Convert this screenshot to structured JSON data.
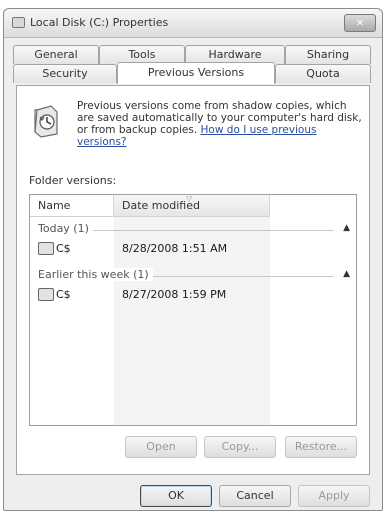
{
  "window": {
    "title": "Local Disk (C:) Properties",
    "close_label": "✕"
  },
  "tabs_row1": [
    {
      "label": "General"
    },
    {
      "label": "Tools"
    },
    {
      "label": "Hardware"
    },
    {
      "label": "Sharing"
    }
  ],
  "tabs_row2": [
    {
      "label": "Security"
    },
    {
      "label": "Previous Versions"
    },
    {
      "label": "Quota"
    }
  ],
  "panel": {
    "info_text": "Previous versions come from shadow copies, which are saved automatically to your computer's hard disk, or from backup copies.",
    "help_link": "How do I use previous versions?",
    "folder_versions_label": "Folder versions:"
  },
  "list": {
    "columns": [
      "Name",
      "Date modified"
    ],
    "groups": [
      {
        "label": "Today (1)",
        "rows": [
          {
            "name": "C$",
            "date": "8/28/2008 1:51 AM"
          }
        ]
      },
      {
        "label": "Earlier this week (1)",
        "rows": [
          {
            "name": "C$",
            "date": "8/27/2008 1:59 PM"
          }
        ]
      }
    ]
  },
  "actions": {
    "open": "Open",
    "copy": "Copy...",
    "restore": "Restore..."
  },
  "footer": {
    "ok": "OK",
    "cancel": "Cancel",
    "apply": "Apply"
  },
  "icons": {
    "window": "drive-icon",
    "panel": "previous-versions-icon",
    "row": "drive-snapshot-icon",
    "group_toggle": "chevron-up-icon"
  }
}
